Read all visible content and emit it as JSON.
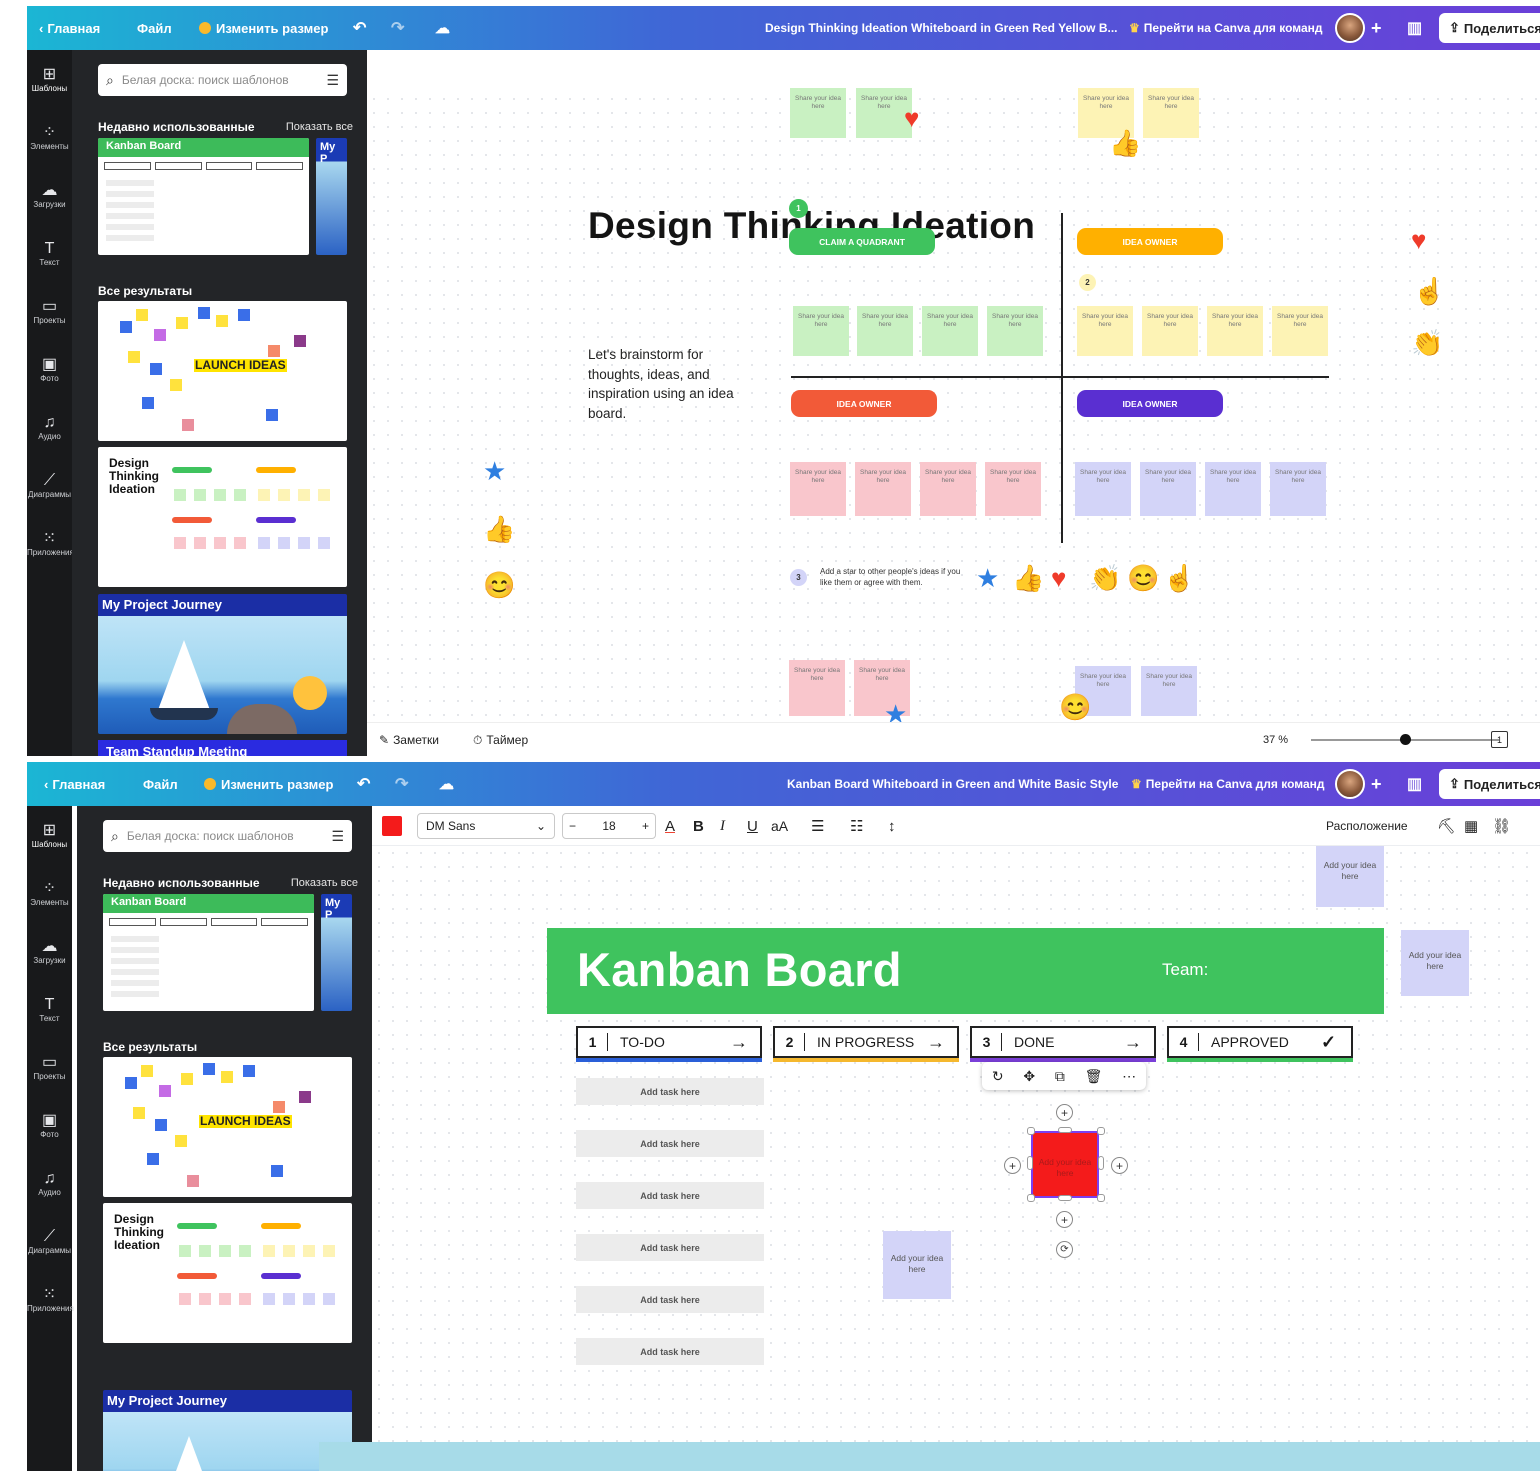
{
  "topbar": {
    "home": "Главная",
    "file": "Файл",
    "resize": "Изменить размер",
    "teams": "Перейти на Canva для команд",
    "plus": "+",
    "share": "Поделиться"
  },
  "rail": [
    {
      "label": "Шаблоны",
      "icon": "templates-icon"
    },
    {
      "label": "Элементы",
      "icon": "elements-icon"
    },
    {
      "label": "Загрузки",
      "icon": "uploads-icon"
    },
    {
      "label": "Текст",
      "icon": "text-icon"
    },
    {
      "label": "Проекты",
      "icon": "folder-icon"
    },
    {
      "label": "Фото",
      "icon": "photo-icon"
    },
    {
      "label": "Аудио",
      "icon": "audio-icon"
    },
    {
      "label": "Диаграммы",
      "icon": "chart-icon"
    },
    {
      "label": "Приложения",
      "icon": "apps-icon"
    }
  ],
  "sidepanel": {
    "search_placeholder": "Белая доска: поиск шаблонов",
    "recent_title": "Недавно использованные",
    "show_all": "Показать все",
    "all_results": "Все результаты",
    "kanban_thumb": "Kanban Board",
    "my_project_short": "My P",
    "launch_text": "LAUNCH IDEAS",
    "dti_thumb_title": "Design Thinking Ideation",
    "journey_thumb": "My Project Journey",
    "standup_thumb": "Team Standup Meeting"
  },
  "panel1": {
    "doc_title": "Design Thinking Ideation Whiteboard in Green Red Yellow B...",
    "board": {
      "title": "Design Thinking Ideation",
      "description": "Let's brainstorm for thoughts, ideas, and inspiration using an idea board.",
      "pill_green": "CLAIM A QUADRANT",
      "pill_yellow": "IDEA OWNER",
      "pill_red": "IDEA OWNER",
      "pill_purple": "IDEA OWNER",
      "note_text": "Share your idea here",
      "step1": "1",
      "step2": "2",
      "step3": "3",
      "star_tip": "Add a star to other people's ideas if you like them or agree with them."
    },
    "bottombar": {
      "notes": "Заметки",
      "timer": "Таймер",
      "zoom": "37 %",
      "zoom_level": 0.5,
      "page": "1"
    }
  },
  "panel2": {
    "doc_title": "Kanban Board Whiteboard in Green and White Basic Style",
    "editor": {
      "text_color": "#f41b1b",
      "font": "DM Sans",
      "font_size": "18",
      "minus": "−",
      "plus": "+",
      "bold": "B",
      "italic": "I",
      "underline": "U",
      "case": "aA",
      "arrange": "Расположение"
    },
    "board": {
      "title": "Kanban Board",
      "team": "Team:",
      "columns": [
        {
          "num": "1",
          "label": "TO-DO",
          "arrow": "→"
        },
        {
          "num": "2",
          "label": "IN PROGRESS",
          "arrow": "→"
        },
        {
          "num": "3",
          "label": "DONE",
          "arrow": "→"
        },
        {
          "num": "4",
          "label": "APPROVED",
          "arrow": "✓"
        }
      ],
      "tasks": [
        "Add task here",
        "Add task here",
        "Add task here",
        "Add task here",
        "Add task here",
        "Add task here"
      ],
      "idea_text": "Add your idea here"
    }
  },
  "colors": {
    "green": "#3fc35e",
    "yellow": "#ffb000",
    "red": "#f25a38",
    "purple": "#5a2fd1",
    "selected_fill": "#f41b1b"
  }
}
